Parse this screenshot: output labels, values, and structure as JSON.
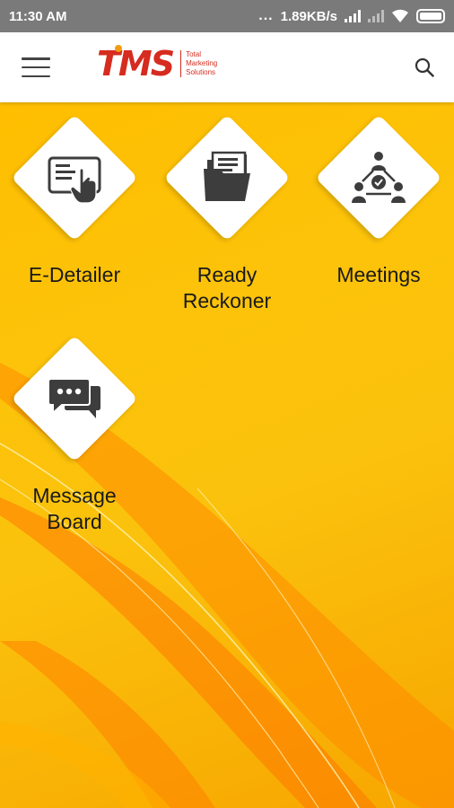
{
  "status_bar": {
    "time": "11:30 AM",
    "dots": "...",
    "speed": "1.89KB/s"
  },
  "header": {
    "logo_mark": "TMS",
    "logo_tagline": [
      "Total",
      "Marketing",
      "Solutions"
    ],
    "brand_color": "#d62b1f",
    "menu_icon": "hamburger-menu-icon",
    "search_icon": "search-icon"
  },
  "tiles": [
    {
      "label_lines": [
        "E-Detailer"
      ],
      "icon": "tablet-touch-icon"
    },
    {
      "label_lines": [
        "Ready",
        "Reckoner"
      ],
      "icon": "folder-documents-icon"
    },
    {
      "label_lines": [
        "Meetings"
      ],
      "icon": "meeting-group-icon"
    },
    {
      "label_lines": [
        "Message",
        "Board"
      ],
      "icon": "chat-bubbles-icon"
    }
  ],
  "colors": {
    "background": "#f7a900",
    "icon_dark": "#3d3d3d",
    "status_bar": "#7a7a7a"
  }
}
